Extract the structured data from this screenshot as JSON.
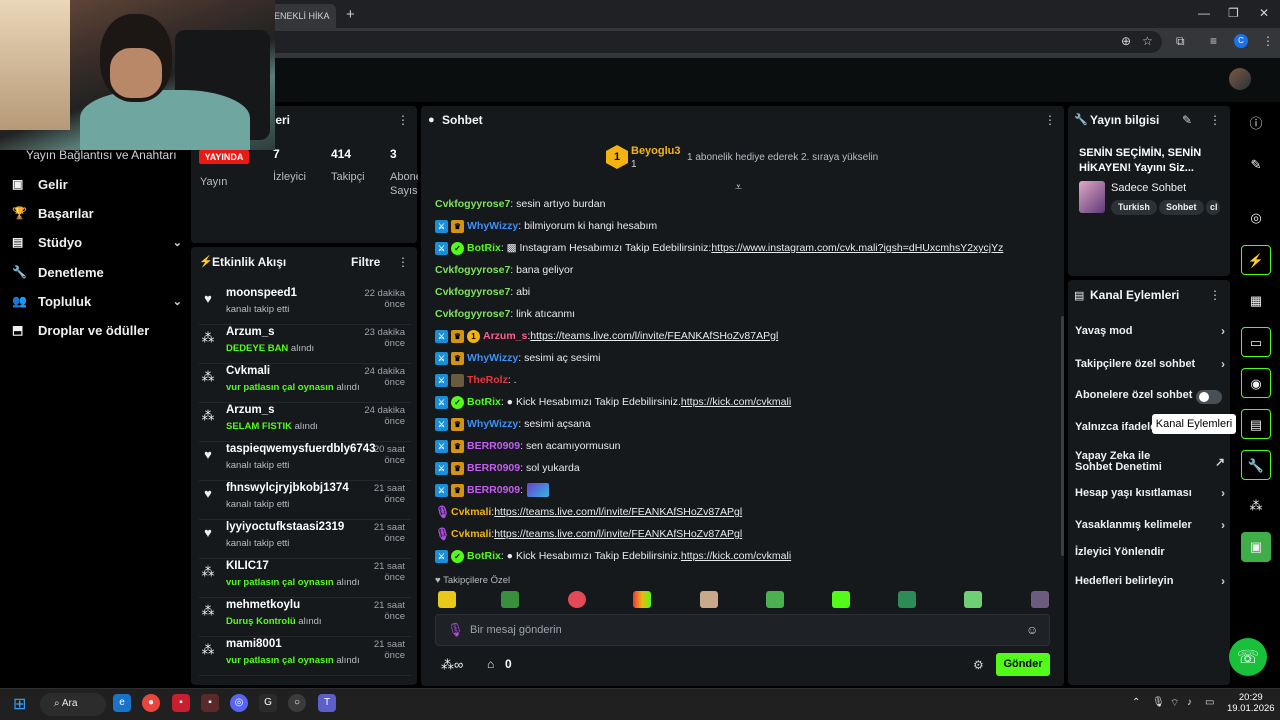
{
  "browser": {
    "tab_title": "ENEKLİ HİKA",
    "new_tab": "+",
    "minimize": "—",
    "maximize": "❐",
    "close": "✕",
    "profile_initial": "C"
  },
  "left_nav": {
    "partial_heading": "Yayın Bağlantısı ve Anahtarı",
    "items": [
      {
        "label": "Gelir",
        "icon": "▣"
      },
      {
        "label": "Başarılar",
        "icon": "🏆"
      },
      {
        "label": "Stüdyo",
        "icon": "▤",
        "chevron": "⌄"
      },
      {
        "label": "Denetleme",
        "icon": "🔧"
      },
      {
        "label": "Topluluk",
        "icon": "👥",
        "chevron": "⌄"
      },
      {
        "label": "Droplar ve ödüller",
        "icon": "⬒"
      }
    ]
  },
  "stats": {
    "title": "tikleri",
    "live_badge": "YAYINDA",
    "cols": [
      {
        "label": "Yayın",
        "value": ""
      },
      {
        "label": "İzleyici",
        "value": "7"
      },
      {
        "label": "Takipçi",
        "value": "414"
      },
      {
        "label": "Abone Sayısı",
        "value": "3"
      }
    ]
  },
  "activity": {
    "title": "Etkinlik Akışı",
    "filter": "Filtre",
    "items": [
      {
        "icon": "♥",
        "user": "moonspeed1",
        "time": "22 dakika önce",
        "pre": "kanalı takip etti",
        "hl": "",
        "post": ""
      },
      {
        "icon": "⁂",
        "user": "Arzum_s",
        "time": "23 dakika önce",
        "pre": "",
        "hl": "DEDEYE BAN",
        "post": " alındı"
      },
      {
        "icon": "⁂",
        "user": "Cvkmali",
        "time": "24 dakika önce",
        "pre": "",
        "hl": "vur patlasın çal oynasın",
        "post": " alındı"
      },
      {
        "icon": "⁂",
        "user": "Arzum_s",
        "time": "24 dakika önce",
        "pre": "",
        "hl": "SELAM FISTIK",
        "post": " alındı"
      },
      {
        "icon": "♥",
        "user": "taspieqwemysfuerdbly6743",
        "time": "20 saat önce",
        "pre": "kanalı takip etti",
        "hl": "",
        "post": ""
      },
      {
        "icon": "♥",
        "user": "fhnswylcjryjbkobj1374",
        "time": "21 saat önce",
        "pre": "kanalı takip etti",
        "hl": "",
        "post": ""
      },
      {
        "icon": "♥",
        "user": "lyyiyoctufkstaasi2319",
        "time": "21 saat önce",
        "pre": "kanalı takip etti",
        "hl": "",
        "post": ""
      },
      {
        "icon": "⁂",
        "user": "KILIC17",
        "time": "21 saat önce",
        "pre": "",
        "hl": "vur patlasın çal oynasın",
        "post": " alındı"
      },
      {
        "icon": "⁂",
        "user": "mehmetkoylu",
        "time": "21 saat önce",
        "pre": "",
        "hl": "Duruş Kontrolü",
        "post": " alındı"
      },
      {
        "icon": "⁂",
        "user": "mami8001",
        "time": "21 saat önce",
        "pre": "",
        "hl": "vur patlasın çal oynasın",
        "post": " alındı"
      }
    ]
  },
  "chat": {
    "title": "Sohbet",
    "pinned": {
      "rank": "1",
      "user": "Beyoglu3",
      "count": "1",
      "message": "1 abonelik hediye ederek 2. sıraya yükselin"
    },
    "messages": [
      {
        "badges": [],
        "user": "Cvkfogyyrose7",
        "color": "#7ee25d",
        "text": ": sesin artıyo burdan",
        "link": ""
      },
      {
        "badges": [
          "mod",
          "sub"
        ],
        "user": "WhyWizzy",
        "color": "#3f8ff5",
        "text": ": bilmiyorum ki hangi hesabım",
        "link": ""
      },
      {
        "badges": [
          "mod",
          "bot"
        ],
        "user": "BotRix",
        "color": "#53fc18",
        "text": ": ▩ Instagram Hesabımızı Takip Edebilirsiniz: ",
        "link": "https://www.instagram.com/cvk.mali?igsh=dHUxcmhsY2xycjYz"
      },
      {
        "badges": [],
        "user": "Cvkfogyyrose7",
        "color": "#7ee25d",
        "text": ": bana geliyor",
        "link": ""
      },
      {
        "badges": [],
        "user": "Cvkfogyyrose7",
        "color": "#7ee25d",
        "text": ": abi",
        "link": ""
      },
      {
        "badges": [],
        "user": "Cvkfogyyrose7",
        "color": "#7ee25d",
        "text": ": link atıcanmı",
        "link": ""
      },
      {
        "badges": [
          "mod",
          "sub",
          "gift"
        ],
        "user": "Arzum_s",
        "color": "#ff5c8a",
        "text": ": ",
        "link": "https://teams.live.com/l/invite/FEANKAfSHoZv87APgl"
      },
      {
        "badges": [
          "mod",
          "sub"
        ],
        "user": "WhyWizzy",
        "color": "#3f8ff5",
        "text": ": sesimi aç sesimi",
        "link": ""
      },
      {
        "badges": [
          "mod",
          "avatar"
        ],
        "user": "TheRolz",
        "color": "#e8383d",
        "text": ": .",
        "link": ""
      },
      {
        "badges": [
          "mod",
          "bot"
        ],
        "user": "BotRix",
        "color": "#53fc18",
        "text": ": ● Kick Hesabımızı Takip Edebilirsiniz. ",
        "link": "https://kick.com/cvkmali"
      },
      {
        "badges": [
          "mod",
          "sub"
        ],
        "user": "WhyWizzy",
        "color": "#3f8ff5",
        "text": ": sesimi açsana",
        "link": ""
      },
      {
        "badges": [
          "mod",
          "sub"
        ],
        "user": "BERR0909",
        "color": "#c55cf5",
        "text": ": sen acamıyormusun",
        "link": ""
      },
      {
        "badges": [
          "mod",
          "sub"
        ],
        "user": "BERR0909",
        "color": "#c55cf5",
        "text": ": sol yukarda",
        "link": ""
      },
      {
        "badges": [
          "mod",
          "sub"
        ],
        "user": "BERR0909",
        "color": "#c55cf5",
        "text": ": ",
        "link": ""
      },
      {
        "badges": [
          "mic"
        ],
        "user": "Cvkmali",
        "color": "#f3b413",
        "text": ": ",
        "link": "https://teams.live.com/l/invite/FEANKAfSHoZv87APgl"
      },
      {
        "badges": [
          "mic"
        ],
        "user": "Cvkmali",
        "color": "#f3b413",
        "text": ": ",
        "link": "https://teams.live.com/l/invite/FEANKAfSHoZv87APgl"
      },
      {
        "badges": [
          "mod",
          "bot"
        ],
        "user": "BotRix",
        "color": "#53fc18",
        "text": ": ● Kick Hesabımızı Takip Edebilirsiniz. ",
        "link": "https://kick.com/cvkmali"
      }
    ],
    "followers_only": "♥ Takipçilere Özel",
    "input_placeholder": "Bir mesaj gönderin",
    "shop_count": "0",
    "send_label": "Gönder"
  },
  "stream_info": {
    "title": "Yayın bilgisi",
    "stream_title": "SENİN SEÇİMİN, SENİN HİKAYEN! Yayını Siz...",
    "category": "Sadece Sohbet",
    "tags": [
      "Turkish",
      "Sohbet",
      "cl"
    ]
  },
  "channel_actions": {
    "title": "Kanal Eylemleri",
    "rows": [
      {
        "label": "Yavaş mod",
        "right": "›"
      },
      {
        "label": "Takipçilere özel sohbet",
        "right": "›"
      },
      {
        "label": "Abonelere özel sohbet",
        "right": ""
      },
      {
        "label": "Yalnızca ifadele",
        "right": ""
      },
      {
        "label": "Yapay Zeka ile Sohbet Denetimi",
        "right": "↗"
      },
      {
        "label": "Hesap yaşı kısıtlaması",
        "right": "›"
      },
      {
        "label": "Yasaklanmış kelimeler",
        "right": "›"
      },
      {
        "label": "İzleyici Yönlendir",
        "right": ""
      },
      {
        "label": "Hedefleri belirleyin",
        "right": "›"
      }
    ],
    "tooltip": "Kanal Eylemleri"
  },
  "taskbar": {
    "search": "Ara",
    "time": "20:29",
    "date": "19.01.2026"
  }
}
